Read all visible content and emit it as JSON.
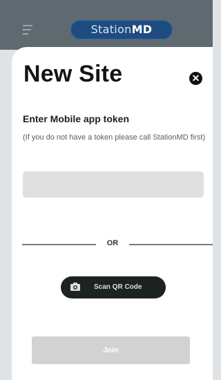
{
  "app_bar": {
    "brand_prefix": "Station",
    "brand_suffix": "MD",
    "menu_icon": "menu-icon"
  },
  "modal": {
    "title": "New Site",
    "close_icon": "close-icon",
    "token_heading": "Enter Mobile app token",
    "token_note": "(If you do not have a token please call StationMD first)",
    "token_input": {
      "value": "",
      "placeholder": ""
    },
    "or_label": "OR",
    "scan_button": {
      "label": "Scan QR Code",
      "icon": "camera-icon"
    },
    "join_button": {
      "label": "Join",
      "state": "disabled"
    }
  },
  "colors": {
    "app_bar": "#5f6970",
    "brand_badge": "#1e4c7f",
    "scan_button": "#1d231f",
    "join_button_disabled": "#d2d2d2",
    "input_background": "#dfdfdf"
  }
}
